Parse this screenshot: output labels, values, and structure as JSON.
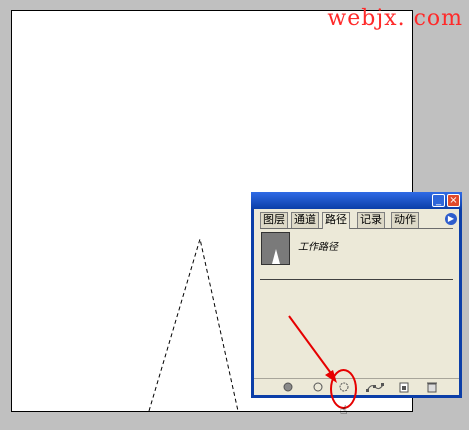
{
  "watermark": "webjx. com",
  "canvas": {
    "background": "#ffffff"
  },
  "panel": {
    "title_bar_color": "#0b3ea8",
    "tabs": [
      {
        "label": "图层"
      },
      {
        "label": "通道"
      },
      {
        "label": "路径",
        "active": true
      },
      {
        "label": "记录"
      },
      {
        "label": "动作"
      }
    ],
    "path_item": {
      "name": "工作路径"
    },
    "bottom_tools": [
      {
        "icon": "fill-path-icon"
      },
      {
        "icon": "stroke-path-icon"
      },
      {
        "icon": "load-path-as-selection-icon"
      },
      {
        "icon": "make-work-path-icon"
      },
      {
        "icon": "create-new-path-icon"
      },
      {
        "icon": "delete-path-icon"
      }
    ]
  },
  "annotation": {
    "highlight_color": "#e60000"
  },
  "cursor": {
    "icon": "hand-cursor-icon"
  }
}
